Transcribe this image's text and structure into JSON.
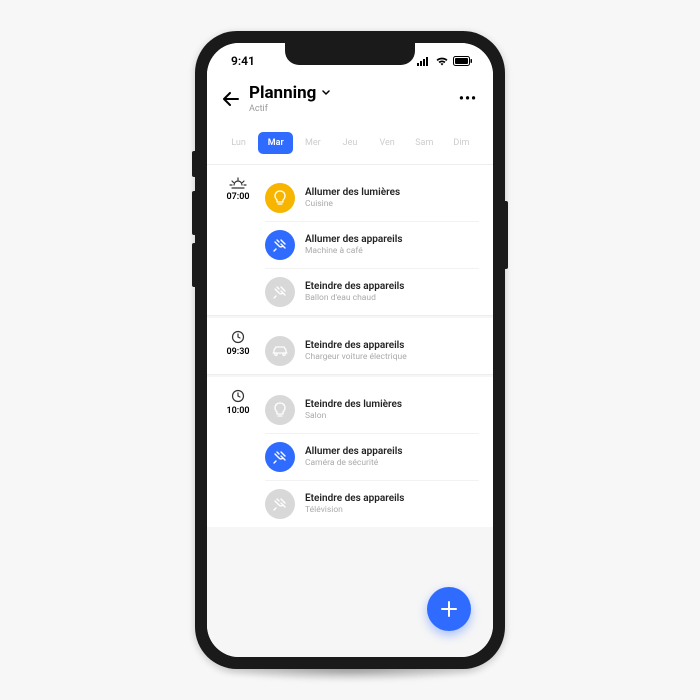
{
  "status": {
    "time": "9:41"
  },
  "header": {
    "title": "Planning",
    "subtitle": "Actif"
  },
  "days": [
    {
      "label": "Lun",
      "active": false
    },
    {
      "label": "Mar",
      "active": true
    },
    {
      "label": "Mer",
      "active": false
    },
    {
      "label": "Jeu",
      "active": false
    },
    {
      "label": "Ven",
      "active": false
    },
    {
      "label": "Sam",
      "active": false
    },
    {
      "label": "Dim",
      "active": false
    }
  ],
  "schedule": [
    {
      "time": "07:00",
      "timeIcon": "sunrise",
      "items": [
        {
          "icon": "bulb",
          "color": "yellow",
          "title": "Allumer des lumières",
          "sub": "Cuisine"
        },
        {
          "icon": "plug",
          "color": "blue",
          "title": "Allumer des appareils",
          "sub": "Machine à café"
        },
        {
          "icon": "plug",
          "color": "grey",
          "title": "Eteindre des appareils",
          "sub": "Ballon d'eau chaud"
        }
      ]
    },
    {
      "time": "09:30",
      "timeIcon": "clock",
      "items": [
        {
          "icon": "car",
          "color": "grey",
          "title": "Eteindre des appareils",
          "sub": "Chargeur voiture électrique"
        }
      ]
    },
    {
      "time": "10:00",
      "timeIcon": "clock",
      "items": [
        {
          "icon": "bulb",
          "color": "grey",
          "title": "Eteindre des lumières",
          "sub": "Salon"
        },
        {
          "icon": "plug",
          "color": "blue",
          "title": "Allumer des appareils",
          "sub": "Caméra de sécurité"
        },
        {
          "icon": "plug",
          "color": "grey",
          "title": "Eteindre des appareils",
          "sub": "Télévision"
        }
      ]
    }
  ],
  "colors": {
    "yellow": "#f7b500",
    "blue": "#2f6bff",
    "grey": "#d8d8d8"
  }
}
